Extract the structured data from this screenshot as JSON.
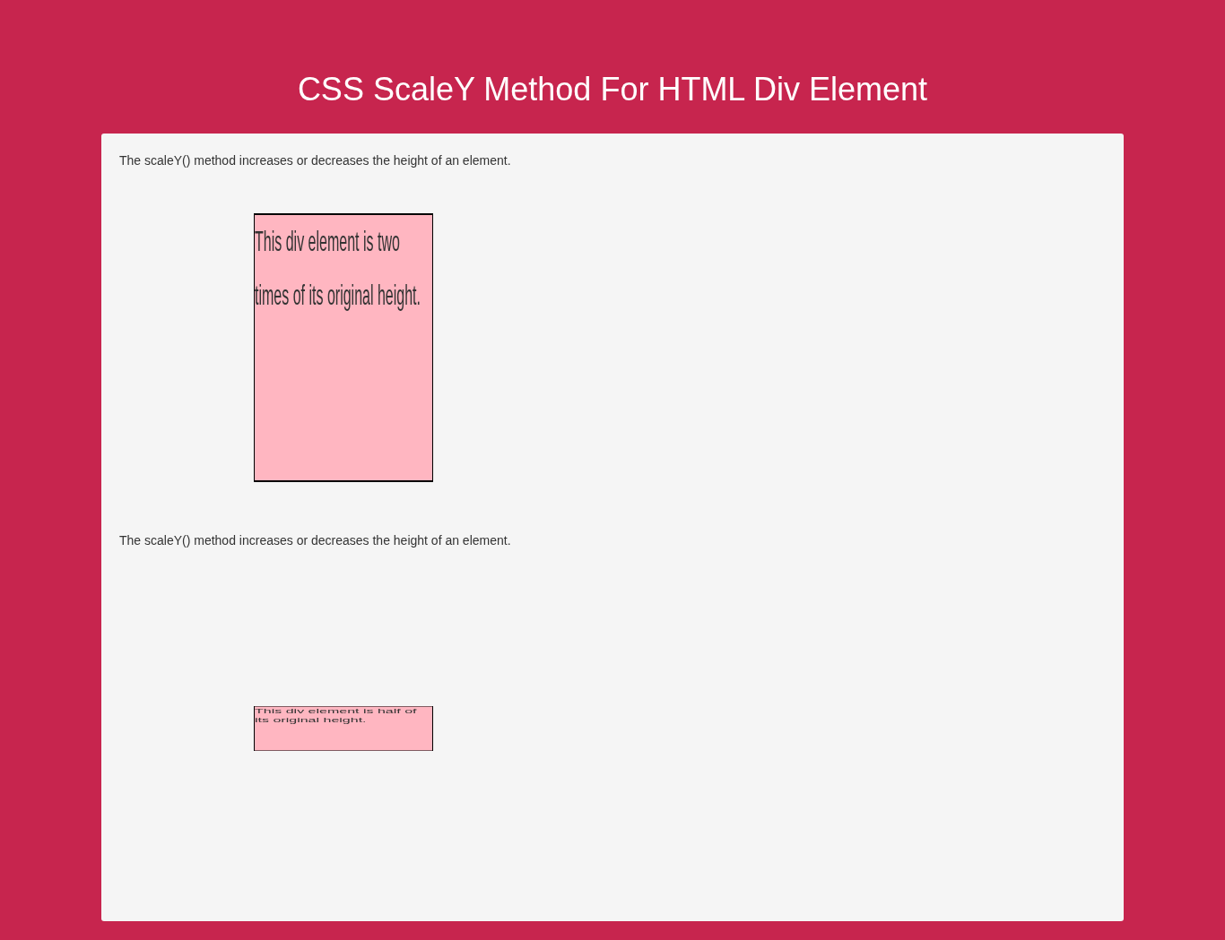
{
  "title": "CSS ScaleY Method For HTML Div Element",
  "demos": [
    {
      "description": "The scaleY() method increases or decreases the height of an element.",
      "kind": "double",
      "box_text": "This div element is two times of its original height."
    },
    {
      "description": "The scaleY() method increases or decreases the height of an element.",
      "kind": "half",
      "box_text": "This div element is half of its original height."
    }
  ]
}
